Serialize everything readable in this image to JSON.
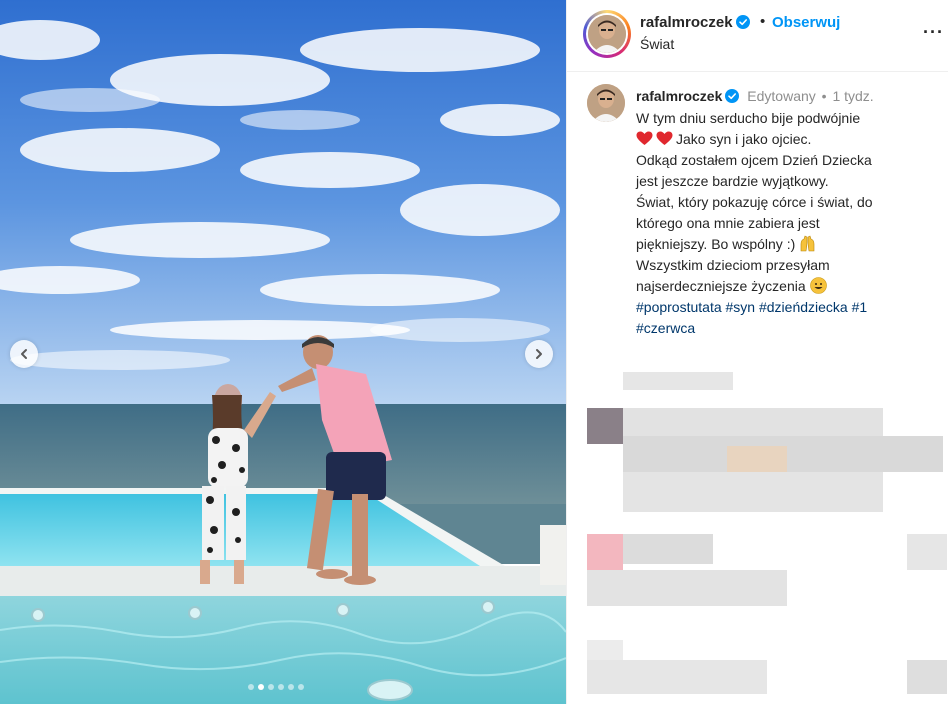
{
  "header": {
    "username": "rafalmroczek",
    "separator": "•",
    "follow_label": "Obserwuj",
    "location": "Świat",
    "more_label": "···"
  },
  "caption": {
    "username": "rafalmroczek",
    "edited": "Edytowany",
    "dot": "•",
    "time": "1 tydz.",
    "lines": [
      "W tym dniu serducho bije podwójnie",
      "Jako syn i jako ojciec.",
      "Odkąd zostałem ojcem Dzień Dziecka",
      "jest jeszcze bardzie wyjątkowy.",
      "Świat, który pokazuję córce i świat, do",
      "którego ona mnie zabiera jest",
      "piękniejszy. Bo wspólny :)",
      "Wszystkim dzieciom przesyłam",
      "najserdeczniejsze życzenia"
    ],
    "hashtags": [
      "#poprostutata",
      "#syn",
      "#dzieńdziecka",
      "#1",
      "#czerwca"
    ]
  },
  "carousel": {
    "total": 6,
    "active_index": 1
  },
  "icons": {
    "verified": "verified-badge-icon",
    "prev": "chevron-left-icon",
    "next": "chevron-right-icon",
    "more": "more-options-icon",
    "hearts": "red-heart-icon",
    "raised_hands": "raising-hands-emoji-icon",
    "smile": "smiling-face-emoji-icon"
  },
  "colors": {
    "accent": "#0095f6",
    "hashtag": "#00376b",
    "muted": "#8e8e8e",
    "heart": "#e0282e"
  }
}
